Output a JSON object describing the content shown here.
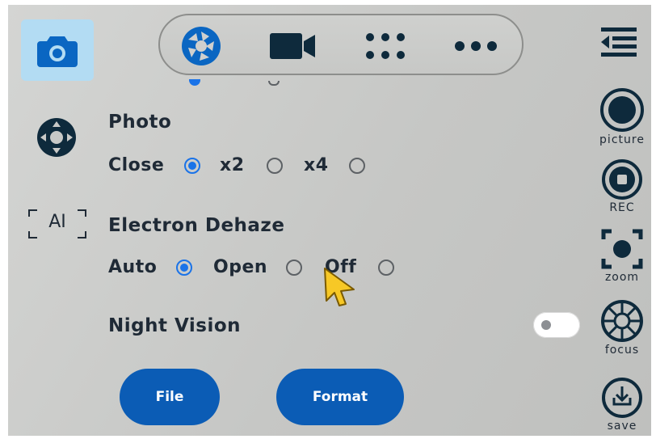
{
  "top_bar": {
    "modes": [
      {
        "icon": "aperture-icon"
      },
      {
        "icon": "video-camera-icon"
      },
      {
        "icon": "grid-dots-icon"
      },
      {
        "icon": "more-dots-icon"
      }
    ]
  },
  "left_rail": {
    "camera_icon": "camera-icon",
    "dpad_icon": "dpad-icon",
    "ai_label": "AI"
  },
  "settings": {
    "photo": {
      "label": "Photo",
      "options": [
        {
          "label": "Close",
          "selected": true
        },
        {
          "label": "x2",
          "selected": false
        },
        {
          "label": "x4",
          "selected": false
        }
      ]
    },
    "dehaze": {
      "label": "Electron Dehaze",
      "options": [
        {
          "label": "Auto",
          "selected": true
        },
        {
          "label": "Open",
          "selected": false
        },
        {
          "label": "Off",
          "selected": false
        }
      ]
    },
    "night_vision": {
      "label": "Night Vision",
      "enabled": false
    }
  },
  "buttons": {
    "file": "File",
    "format": "Format"
  },
  "right_rail": {
    "picture": "picture",
    "rec": "REC",
    "zoom": "zoom",
    "focus": "focus",
    "save": "save"
  },
  "colors": {
    "accent": "#1a73e8",
    "button_blue": "#0b5cb5",
    "icon_dark": "#0e2a3c",
    "camera_bg": "#b3dcf3"
  }
}
